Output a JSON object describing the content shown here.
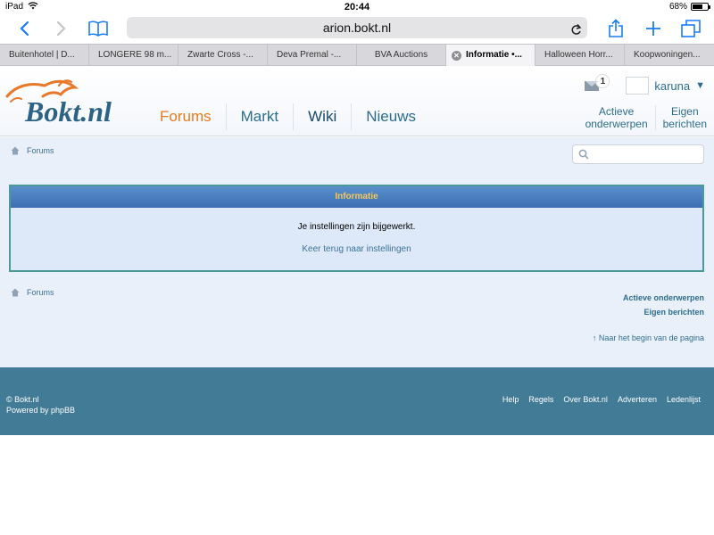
{
  "status_bar": {
    "device": "iPad",
    "time": "20:44",
    "battery": "68%",
    "battery_level": 0.68
  },
  "browser": {
    "url": "arion.bokt.nl",
    "tabs": [
      {
        "label": "Buitenhotel | D..."
      },
      {
        "label": "LONGERE 98 m..."
      },
      {
        "label": "Zwarte Cross -..."
      },
      {
        "label": "Deva Premal -..."
      },
      {
        "label": "BVA Auctions"
      },
      {
        "label": "Informatie •..."
      },
      {
        "label": "Halloween Horr..."
      },
      {
        "label": "Koopwoningen..."
      }
    ]
  },
  "header": {
    "logo_text": "Bokt.nl",
    "nav": [
      {
        "label": "Forums"
      },
      {
        "label": "Markt"
      },
      {
        "label": "Wiki"
      },
      {
        "label": "Nieuws"
      }
    ],
    "notification_count": "1",
    "username": "karuna",
    "quick_links": [
      {
        "line1": "Actieve",
        "line2": "onderwerpen"
      },
      {
        "line1": "Eigen",
        "line2": "berichten"
      }
    ]
  },
  "breadcrumb": {
    "top": "Forums",
    "bottom": "Forums"
  },
  "panel": {
    "title": "Informatie",
    "message": "Je instellingen zijn bijgewerkt.",
    "link": "Keer terug naar instellingen"
  },
  "bottom_links": {
    "active_topics": "Actieve onderwerpen",
    "own_posts": "Eigen berichten",
    "back_to_top": "↑ Naar het begin van de pagina"
  },
  "footer": {
    "copyright": "© Bokt.nl",
    "powered": "Powered by phpBB",
    "links": [
      {
        "label": "Help"
      },
      {
        "label": "Regels"
      },
      {
        "label": "Over Bokt.nl"
      },
      {
        "label": "Adverteren"
      },
      {
        "label": "Ledenlijst"
      }
    ]
  },
  "colors": {
    "accent": "#1a7cf5",
    "brand_blue": "#2d6d8d",
    "nav_active": "#e87a1e",
    "footer_bg": "#427b96"
  }
}
